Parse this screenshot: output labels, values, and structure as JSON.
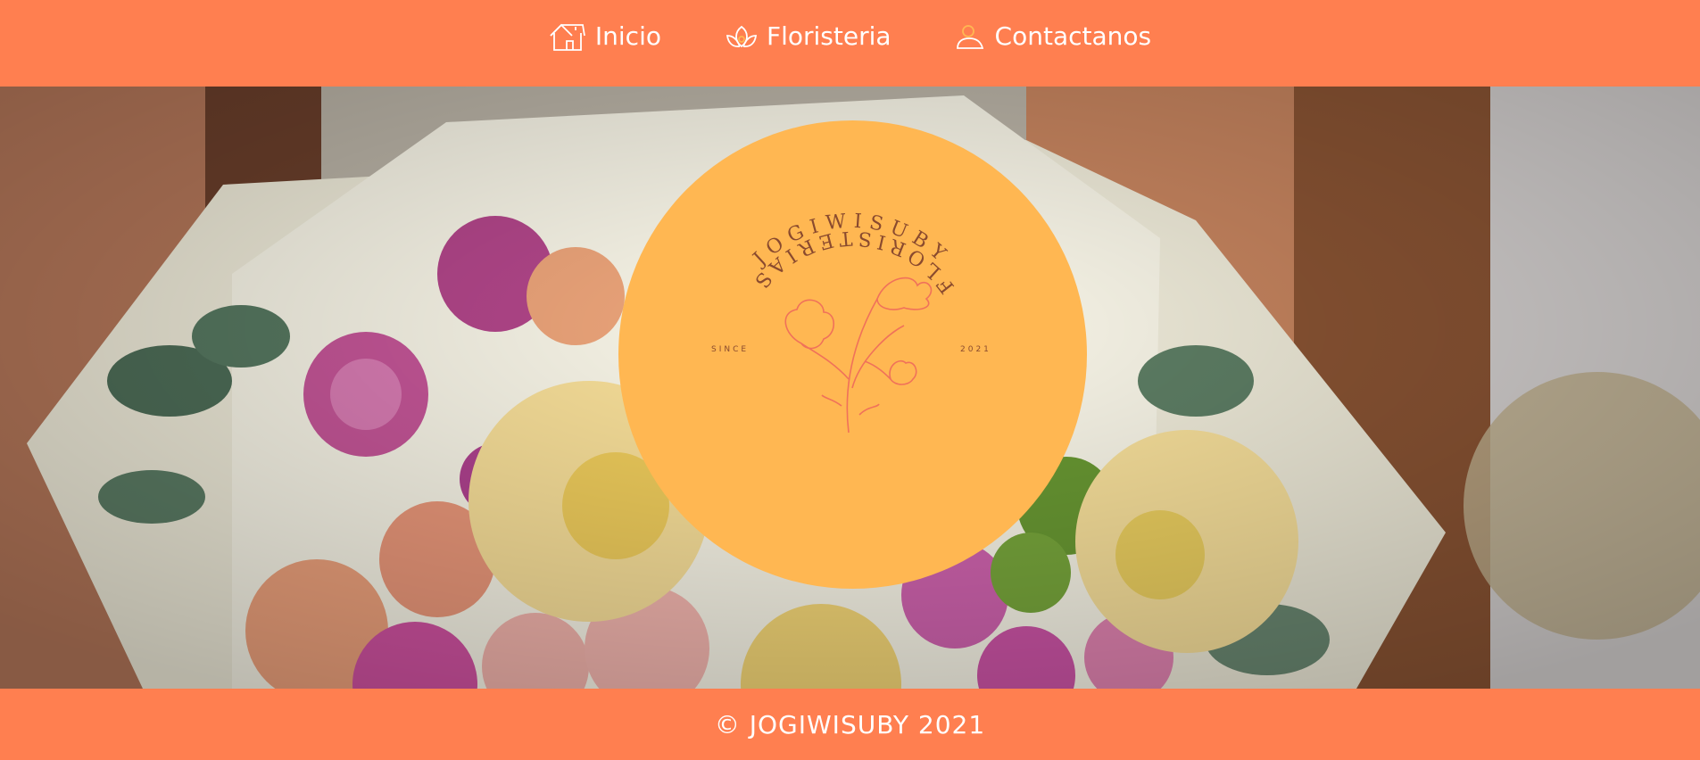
{
  "nav": {
    "items": [
      {
        "label": "Inicio",
        "icon": "home-icon"
      },
      {
        "label": "Floristeria",
        "icon": "lotus-icon"
      },
      {
        "label": "Contactanos",
        "icon": "user-icon"
      }
    ]
  },
  "logo": {
    "brand": "JOGIWISUBY",
    "tagline": "FLORISTERIAS",
    "since_label": "SINCE",
    "year": "2021",
    "icon": "flower-bouquet-icon"
  },
  "footer": {
    "text": "© JOGIWISUBY 2021"
  },
  "colors": {
    "primary": "#ff7f50",
    "logo_bg": "#ffb752",
    "logo_text": "#8a4a2e",
    "logo_flower": "#f0715a"
  }
}
